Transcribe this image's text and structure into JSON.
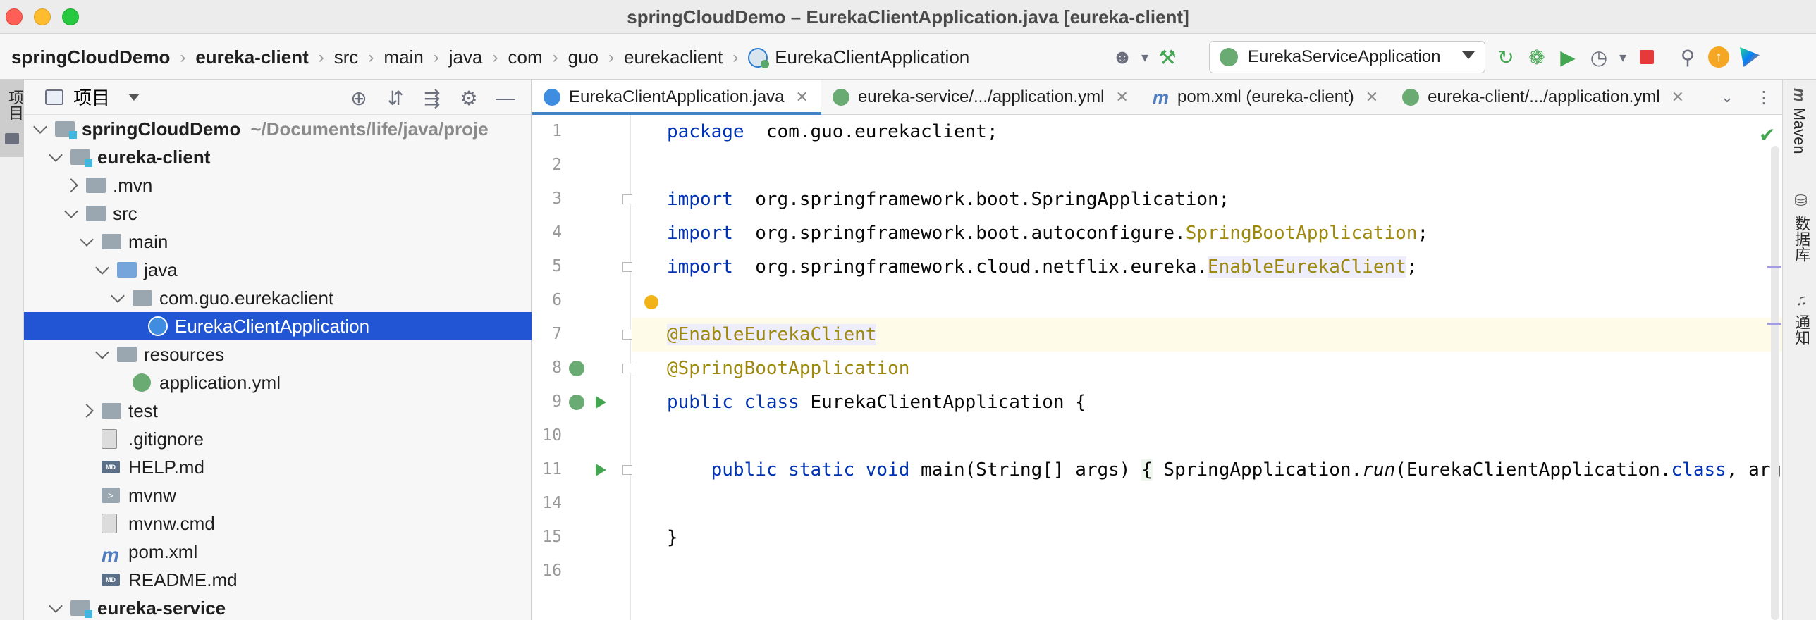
{
  "window": {
    "title": "springCloudDemo – EurekaClientApplication.java [eureka-client]"
  },
  "breadcrumbs": [
    {
      "label": "springCloudDemo",
      "bold": true
    },
    {
      "label": "eureka-client",
      "bold": true
    },
    {
      "label": "src"
    },
    {
      "label": "main"
    },
    {
      "label": "java"
    },
    {
      "label": "com"
    },
    {
      "label": "guo"
    },
    {
      "label": "eurekaclient"
    },
    {
      "label": "EurekaClientApplication",
      "icon": "spring-class-icon"
    }
  ],
  "toolbar": {
    "run_config": "EurekaServiceApplication",
    "icons": [
      "user-icon",
      "build-hammer-icon",
      "rerun-icon",
      "debug-icon",
      "coverage-icon",
      "profiler-icon",
      "stop-icon",
      "search-icon",
      "update-icon",
      "toolbox-icon"
    ]
  },
  "left_strip": {
    "project_tab": "项目"
  },
  "project_panel": {
    "title": "项目",
    "tools": [
      "locate-icon",
      "expand-all-icon",
      "collapse-all-icon",
      "settings-gear-icon",
      "hide-icon"
    ],
    "tree": [
      {
        "label": "springCloudDemo",
        "hint": "~/Documents/life/java/proje",
        "depth": 0,
        "state": "open",
        "icon": "module-folder",
        "bold": true
      },
      {
        "label": "eureka-client",
        "depth": 1,
        "state": "open",
        "icon": "module-folder",
        "bold": true
      },
      {
        "label": ".mvn",
        "depth": 2,
        "state": "closed",
        "icon": "folder"
      },
      {
        "label": "src",
        "depth": 2,
        "state": "open",
        "icon": "folder"
      },
      {
        "label": "main",
        "depth": 3,
        "state": "open",
        "icon": "folder"
      },
      {
        "label": "java",
        "depth": 4,
        "state": "open",
        "icon": "folder-blue"
      },
      {
        "label": "com.guo.eurekaclient",
        "depth": 5,
        "state": "open",
        "icon": "package"
      },
      {
        "label": "EurekaClientApplication",
        "depth": 6,
        "state": "none",
        "icon": "class",
        "selected": true
      },
      {
        "label": "resources",
        "depth": 4,
        "state": "open",
        "icon": "resources-folder"
      },
      {
        "label": "application.yml",
        "depth": 5,
        "state": "none",
        "icon": "spring-yml"
      },
      {
        "label": "test",
        "depth": 3,
        "state": "closed",
        "icon": "folder"
      },
      {
        "label": ".gitignore",
        "depth": 3,
        "state": "none",
        "icon": "file"
      },
      {
        "label": "HELP.md",
        "depth": 3,
        "state": "none",
        "icon": "md"
      },
      {
        "label": "mvnw",
        "depth": 3,
        "state": "none",
        "icon": "terminal"
      },
      {
        "label": "mvnw.cmd",
        "depth": 3,
        "state": "none",
        "icon": "file"
      },
      {
        "label": "pom.xml",
        "depth": 3,
        "state": "none",
        "icon": "maven"
      },
      {
        "label": "README.md",
        "depth": 3,
        "state": "none",
        "icon": "md"
      },
      {
        "label": "eureka-service",
        "depth": 1,
        "state": "open",
        "icon": "module-folder",
        "bold": true
      }
    ]
  },
  "editor": {
    "tabs": [
      {
        "label": "EurekaClientApplication.java",
        "icon": "java",
        "active": true
      },
      {
        "label": "eureka-service/.../application.yml",
        "icon": "yml"
      },
      {
        "label": "pom.xml (eureka-client)",
        "icon": "m"
      },
      {
        "label": "eureka-client/.../application.yml",
        "icon": "yml"
      }
    ],
    "lines": [
      {
        "n": "1",
        "parts": [
          [
            "kw",
            "package"
          ],
          [
            "",
            "  com.guo.eurekaclient;"
          ]
        ]
      },
      {
        "n": "2",
        "parts": []
      },
      {
        "n": "3",
        "parts": [
          [
            "kw",
            "import"
          ],
          [
            "",
            "  org.springframework.boot.SpringApplication;"
          ]
        ],
        "fold": true
      },
      {
        "n": "4",
        "parts": [
          [
            "kw",
            "import"
          ],
          [
            "",
            "  org.springframework.boot.autoconfigure."
          ],
          [
            "ann",
            "SpringBootApplication"
          ],
          [
            "",
            ";"
          ]
        ]
      },
      {
        "n": "5",
        "parts": [
          [
            "kw",
            "import"
          ],
          [
            "",
            "  org.springframework.cloud.netflix.eureka."
          ],
          [
            "ann hl-ref",
            "EnableEurekaClient"
          ],
          [
            "",
            ";"
          ]
        ],
        "fold": true
      },
      {
        "n": "6",
        "parts": [],
        "bulb": true
      },
      {
        "n": "7",
        "parts": [
          [
            "ann hl-ref",
            "@EnableEurekaClient"
          ]
        ],
        "fold": true,
        "current": true
      },
      {
        "n": "8",
        "parts": [
          [
            "ann",
            "@SpringBootApplication"
          ]
        ],
        "spring": true,
        "fold": true
      },
      {
        "n": "9",
        "parts": [
          [
            "kw",
            "public class"
          ],
          [
            "",
            " EurekaClientApplication {"
          ]
        ],
        "spring": true,
        "run": true
      },
      {
        "n": "10",
        "parts": []
      },
      {
        "n": "11",
        "parts": [
          [
            "",
            "    "
          ],
          [
            "kw",
            "public static void"
          ],
          [
            "",
            " main(String[] args) "
          ],
          [
            "brace-box",
            "{"
          ],
          [
            "",
            " SpringApplication."
          ],
          [
            "static-call",
            "run"
          ],
          [
            "",
            "(EurekaClientApplication."
          ],
          [
            "kw",
            "class"
          ],
          [
            "",
            ", args); "
          ],
          [
            "brace-box",
            "}"
          ]
        ],
        "run": true,
        "fold": true
      },
      {
        "n": "14",
        "parts": []
      },
      {
        "n": "15",
        "parts": [
          [
            "",
            "}"
          ]
        ]
      },
      {
        "n": "16",
        "parts": []
      }
    ]
  },
  "right_strip": {
    "tabs": [
      {
        "label": "Maven",
        "icon": "m"
      },
      {
        "label": "数据库",
        "icon": "database-icon"
      },
      {
        "label": "通知",
        "icon": "bell-icon"
      }
    ]
  }
}
